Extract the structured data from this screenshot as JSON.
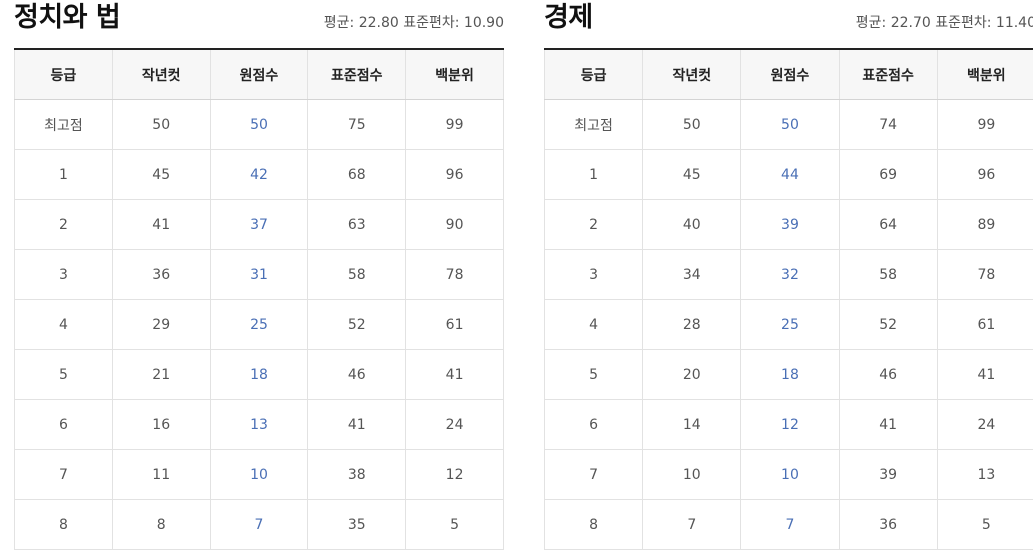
{
  "columns": [
    "등급",
    "작년컷",
    "원점수",
    "표준점수",
    "백분위"
  ],
  "left": {
    "title": "정치와 법",
    "stats": "평균: 22.80 표준편차: 10.90",
    "rows": [
      [
        "최고점",
        "50",
        "50",
        "75",
        "99"
      ],
      [
        "1",
        "45",
        "42",
        "68",
        "96"
      ],
      [
        "2",
        "41",
        "37",
        "63",
        "90"
      ],
      [
        "3",
        "36",
        "31",
        "58",
        "78"
      ],
      [
        "4",
        "29",
        "25",
        "52",
        "61"
      ],
      [
        "5",
        "21",
        "18",
        "46",
        "41"
      ],
      [
        "6",
        "16",
        "13",
        "41",
        "24"
      ],
      [
        "7",
        "11",
        "10",
        "38",
        "12"
      ],
      [
        "8",
        "8",
        "7",
        "35",
        "5"
      ]
    ]
  },
  "right": {
    "title": "경제",
    "stats": "평균: 22.70 표준편차: 11.40",
    "rows": [
      [
        "최고점",
        "50",
        "50",
        "74",
        "99"
      ],
      [
        "1",
        "45",
        "44",
        "69",
        "96"
      ],
      [
        "2",
        "40",
        "39",
        "64",
        "89"
      ],
      [
        "3",
        "34",
        "32",
        "58",
        "78"
      ],
      [
        "4",
        "28",
        "25",
        "52",
        "61"
      ],
      [
        "5",
        "20",
        "18",
        "46",
        "41"
      ],
      [
        "6",
        "14",
        "12",
        "41",
        "24"
      ],
      [
        "7",
        "10",
        "10",
        "39",
        "13"
      ],
      [
        "8",
        "7",
        "7",
        "36",
        "5"
      ]
    ]
  },
  "colors": {
    "raw_score": "#4a6fb5",
    "header_bg": "#f7f7f7",
    "border": "#e2e2e2"
  }
}
